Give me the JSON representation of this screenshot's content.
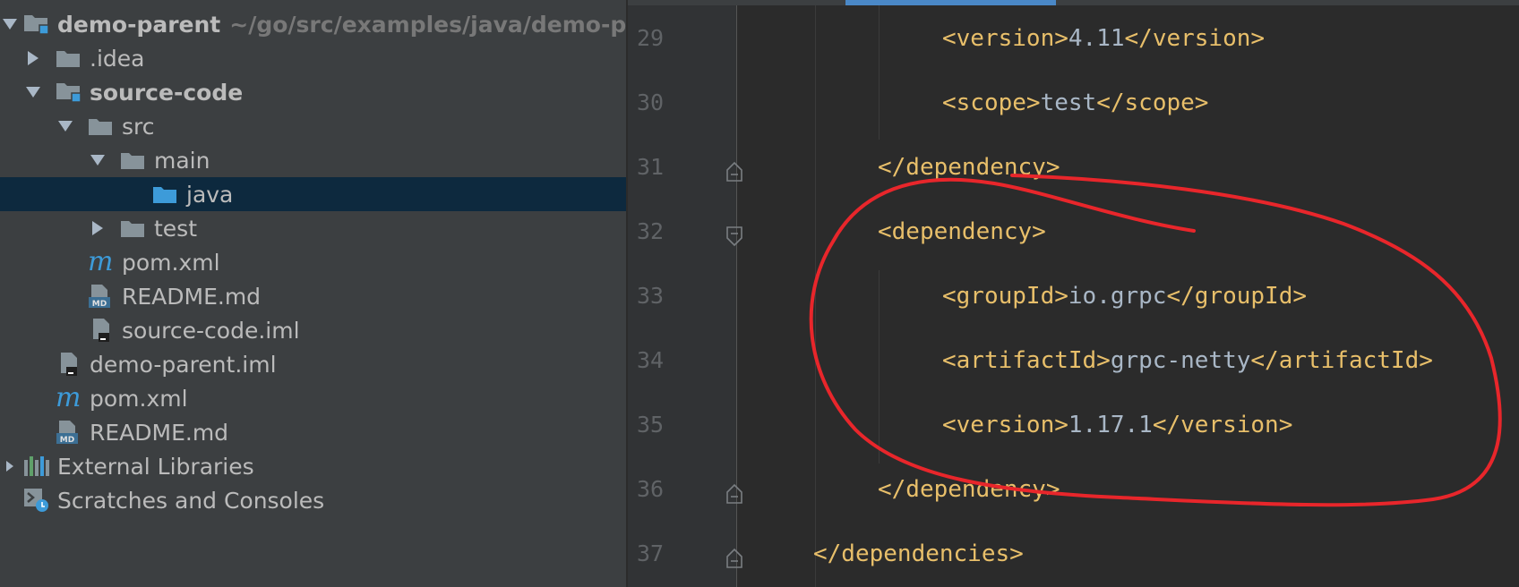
{
  "project_tree": {
    "items": [
      {
        "label": "demo-parent",
        "path": "~/go/src/examples/java/demo-pa",
        "icon": "module-folder-icon",
        "arrow": "down",
        "bold": true
      },
      {
        "label": ".idea",
        "icon": "folder-icon",
        "arrow": "right",
        "bold": false
      },
      {
        "label": "source-code",
        "icon": "module-folder-icon",
        "arrow": "down",
        "bold": true
      },
      {
        "label": "src",
        "icon": "folder-icon",
        "arrow": "down",
        "bold": false
      },
      {
        "label": "main",
        "icon": "folder-icon",
        "arrow": "down",
        "bold": false
      },
      {
        "label": "java",
        "icon": "source-folder-icon",
        "arrow": "none",
        "bold": false,
        "selected": true
      },
      {
        "label": "test",
        "icon": "folder-icon",
        "arrow": "right",
        "bold": false
      },
      {
        "label": "pom.xml",
        "icon": "maven-icon",
        "arrow": "none",
        "bold": false
      },
      {
        "label": "README.md",
        "icon": "markdown-file-icon",
        "arrow": "none",
        "bold": false
      },
      {
        "label": "source-code.iml",
        "icon": "iml-file-icon",
        "arrow": "none",
        "bold": false
      },
      {
        "label": "demo-parent.iml",
        "icon": "iml-file-icon",
        "arrow": "none",
        "bold": false
      },
      {
        "label": "pom.xml",
        "icon": "maven-icon",
        "arrow": "none",
        "bold": false
      },
      {
        "label": "README.md",
        "icon": "markdown-file-icon",
        "arrow": "none",
        "bold": false
      },
      {
        "label": "External Libraries",
        "icon": "libraries-icon",
        "arrow": "right-small",
        "bold": false
      },
      {
        "label": "Scratches and Consoles",
        "icon": "scratches-icon",
        "arrow": "none",
        "bold": false
      }
    ],
    "icon_text": {
      "maven": "m",
      "markdown": "MD"
    }
  },
  "editor": {
    "lines": [
      {
        "num": "29",
        "indent": 4,
        "open_tag": "<version>",
        "text": "4.11",
        "close_tag": "</version>"
      },
      {
        "num": "30",
        "indent": 4,
        "open_tag": "<scope>",
        "text": "test",
        "close_tag": "</scope>"
      },
      {
        "num": "31",
        "indent": 3,
        "open_tag": "</dependency>",
        "text": "",
        "close_tag": "",
        "fold": "end"
      },
      {
        "num": "32",
        "indent": 3,
        "open_tag": "<dependency>",
        "text": "",
        "close_tag": "",
        "fold": "start"
      },
      {
        "num": "33",
        "indent": 4,
        "open_tag": "<groupId>",
        "text": "io.grpc",
        "close_tag": "</groupId>"
      },
      {
        "num": "34",
        "indent": 4,
        "open_tag": "<artifactId>",
        "text": "grpc-netty",
        "close_tag": "</artifactId>"
      },
      {
        "num": "35",
        "indent": 4,
        "open_tag": "<version>",
        "text": "1.17.1",
        "close_tag": "</version>"
      },
      {
        "num": "36",
        "indent": 3,
        "open_tag": "</dependency>",
        "text": "",
        "close_tag": "",
        "fold": "end"
      },
      {
        "num": "37",
        "indent": 2,
        "open_tag": "</dependencies>",
        "text": "",
        "close_tag": "",
        "fold": "end"
      }
    ]
  },
  "colors": {
    "tree_background": "#3c3f41",
    "selection": "#0d293e",
    "editor_background": "#2b2b2b",
    "xml_tag": "#e8bf6a",
    "xml_text": "#a9b7c6",
    "line_number": "#606366",
    "annotation": "#e8262b",
    "maven_icon": "#3d9bd9"
  }
}
